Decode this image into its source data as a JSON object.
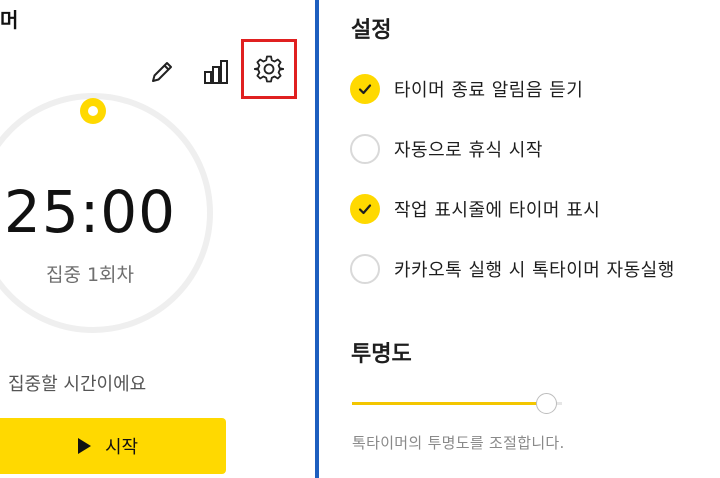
{
  "app": {
    "title_fragment": "머"
  },
  "toolbar": {
    "edit_icon": "pencil-icon",
    "stats_icon": "bar-chart-icon",
    "settings_icon": "gear-icon",
    "settings_highlight_color": "#e02020"
  },
  "timer": {
    "time": "25:00",
    "session": "집중 1회차",
    "hint": "집중할 시간이에요",
    "progress": 0,
    "ring_color": "#efefef",
    "marker_color": "#ffd900"
  },
  "start_button": {
    "label": "시작",
    "icon": "play-icon",
    "color": "#ffd900"
  },
  "settings": {
    "title": "설정",
    "options": [
      {
        "label": "타이머 종료 알림음 듣기",
        "checked": true
      },
      {
        "label": "자동으로 휴식 시작",
        "checked": false
      },
      {
        "label": "작업 표시줄에 타이머 표시",
        "checked": true
      },
      {
        "label": "카카오톡 실행 시 톡타이머 자동실행",
        "checked": false
      }
    ]
  },
  "opacity": {
    "title": "투명도",
    "value_percent": 93,
    "description": "톡타이머의 투명도를 조절합니다.",
    "accent_color": "#f3c600"
  },
  "divider_color": "#1d5fbf"
}
